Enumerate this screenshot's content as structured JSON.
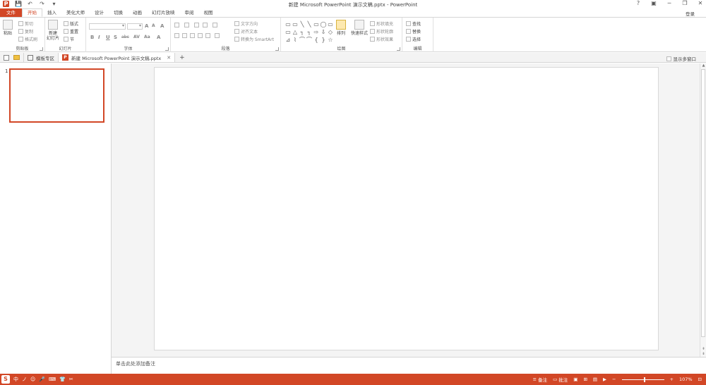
{
  "window": {
    "title": "新建 Microsoft PowerPoint 演示文稿.pptx - PowerPoint",
    "controls": [
      "?",
      "▣",
      "─",
      "❐",
      "✕"
    ],
    "qat": [
      "P",
      "💾",
      "↶",
      "↷",
      "▾"
    ]
  },
  "ribbon_tabs": [
    "文件",
    "开始",
    "插入",
    "美化大师",
    "设计",
    "切换",
    "动画",
    "幻灯片放映",
    "审阅",
    "视图"
  ],
  "active_tab": "开始",
  "login_label": "登录",
  "ribbon": {
    "clipboard": {
      "paste": "粘贴",
      "cut": "剪切",
      "copy": "复制",
      "format_painter": "格式刷",
      "label": "剪贴板"
    },
    "slides": {
      "new_slide": "新建\n幻灯片",
      "layout": "版式",
      "reset": "重置",
      "section": "节",
      "label": "幻灯片"
    },
    "font": {
      "label": "字体",
      "bold": "B",
      "italic": "I",
      "underline": "U",
      "shadow": "S",
      "strike": "abc",
      "spacing": "AV",
      "case": "Aa",
      "color": "A",
      "grow": "A",
      "shrink": "A",
      "clear": "A"
    },
    "paragraph": {
      "text_direction": "文字方向",
      "align_text": "对齐文本",
      "smartart": "转换为 SmartArt",
      "label": "段落"
    },
    "drawing": {
      "arrange": "排列",
      "quick_styles": "快速样式",
      "shape_fill": "形状填充",
      "shape_outline": "形状轮廓",
      "shape_effects": "形状效果",
      "label": "绘图"
    },
    "editing": {
      "find": "查找",
      "replace": "替换",
      "select": "选择",
      "label": "编辑"
    }
  },
  "shapes_gallery": [
    "▭",
    "▭",
    "╲",
    "╲",
    "▭",
    "◯",
    "▭",
    "▭",
    "△",
    "┐",
    "┐",
    "⇨",
    "⇩",
    "◇",
    "⊿",
    "⌇",
    "⌒",
    "⌒",
    "{",
    "}",
    "☆"
  ],
  "doc_tabs": [
    {
      "label": "模板专区"
    },
    {
      "label": "新建 Microsoft PowerPoint 演示文稿.pptx",
      "close": "✕"
    }
  ],
  "new_tab": "+",
  "multi_window": "显示多窗口",
  "slide_number": "1",
  "notes_placeholder": "单击此处添加备注",
  "ime_bar": {
    "logo": "S",
    "items": [
      "中",
      "ノ",
      "☺",
      "🎤",
      "⌨",
      "👕",
      "✂"
    ]
  },
  "status": {
    "notes_btn": "备注",
    "comments_btn": "批注",
    "zoom_minus": "−",
    "zoom_plus": "+",
    "zoom_level": "107%",
    "zoom_fraction": 0.55
  },
  "colors": {
    "accent": "#d24726"
  }
}
